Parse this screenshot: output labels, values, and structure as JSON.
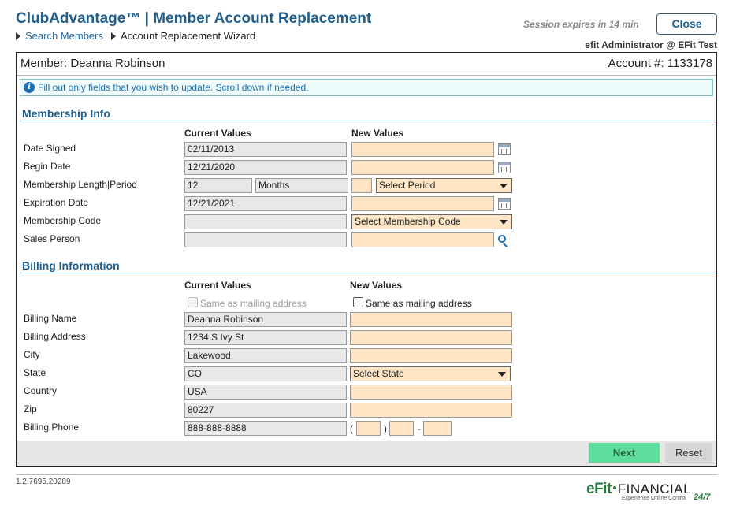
{
  "header": {
    "title": "ClubAdvantage™ | Member Account Replacement",
    "breadcrumb": {
      "link": "Search Members",
      "current": "Account Replacement Wizard"
    },
    "session_text": "Session expires in 14 min",
    "close_label": "Close",
    "admin_text": "efit Administrator @ EFit Test"
  },
  "member": {
    "name_text": "Member: Deanna Robinson",
    "account_text": "Account #: 1133178"
  },
  "info": {
    "icon": "info-icon",
    "text": "Fill out only fields that you wish to update. Scroll down if needed."
  },
  "membership": {
    "title": "Membership Info",
    "current_header": "Current Values",
    "new_header": "New Values",
    "rows": {
      "date_signed": {
        "label": "Date Signed",
        "current": "02/11/2013",
        "new": ""
      },
      "begin_date": {
        "label": "Begin Date",
        "current": "12/21/2020",
        "new": ""
      },
      "length_period": {
        "label": "Membership Length|Period",
        "current_length": "12",
        "current_period": "Months",
        "new_length": "",
        "new_period": "Select Period"
      },
      "expiration_date": {
        "label": "Expiration Date",
        "current": "12/21/2021",
        "new": ""
      },
      "membership_code": {
        "label": "Membership Code",
        "current": "",
        "new": "Select Membership Code"
      },
      "sales_person": {
        "label": "Sales Person",
        "current": "",
        "new": ""
      }
    }
  },
  "billing": {
    "title": "Billing Information",
    "current_header": "Current Values",
    "new_header": "New Values",
    "same_as_mailing_current": "Same as mailing address",
    "same_as_mailing_new": "Same as mailing address",
    "rows": {
      "name": {
        "label": "Billing Name",
        "current": "Deanna Robinson",
        "new": ""
      },
      "address": {
        "label": "Billing Address",
        "current": "1234 S Ivy St",
        "new": ""
      },
      "city": {
        "label": "City",
        "current": "Lakewood",
        "new": ""
      },
      "state": {
        "label": "State",
        "current": "CO",
        "new": "Select State"
      },
      "country": {
        "label": "Country",
        "current": "USA",
        "new": ""
      },
      "zip": {
        "label": "Zip",
        "current": "80227",
        "new": ""
      },
      "phone": {
        "label": "Billing Phone",
        "current": "888-888-8888",
        "open_paren": "(",
        "close_paren": ")",
        "dash": "-"
      }
    }
  },
  "actions": {
    "next_label": "Next",
    "reset_label": "Reset"
  },
  "footer": {
    "version": "1.2.7695.20289",
    "logo_efit": "eFit",
    "logo_financial": "FINANCIAL",
    "tagline": "Experience Online Control",
    "tag247": "24/7"
  },
  "colors": {
    "accent": "#1f5f8e",
    "new_field_bg": "#fde5c5",
    "next_button": "#5edc9c"
  }
}
